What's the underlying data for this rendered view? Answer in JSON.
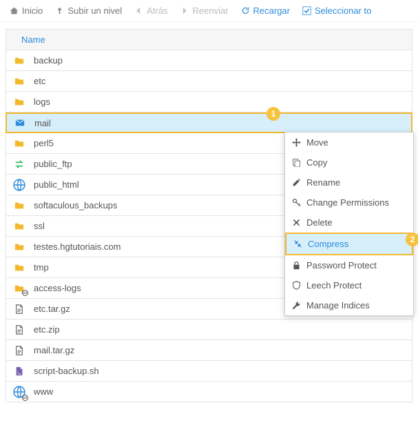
{
  "toolbar": {
    "home": "Inicio",
    "up": "Subir un nivel",
    "back": "Atrás",
    "forward": "Reenviar",
    "reload": "Recargar",
    "select_all": "Seleccionar to"
  },
  "header": {
    "name": "Name"
  },
  "badges": {
    "one": "1",
    "two": "2"
  },
  "rows": [
    {
      "type": "folder",
      "label": "backup"
    },
    {
      "type": "folder",
      "label": "etc"
    },
    {
      "type": "folder",
      "label": "logs"
    },
    {
      "type": "mail",
      "label": "mail",
      "selected": true
    },
    {
      "type": "folder",
      "label": "perl5"
    },
    {
      "type": "ftp",
      "label": "public_ftp"
    },
    {
      "type": "globe",
      "label": "public_html"
    },
    {
      "type": "folder",
      "label": "softaculous_backups"
    },
    {
      "type": "folder",
      "label": "ssl"
    },
    {
      "type": "folder",
      "label": "testes.hgtutoriais.com"
    },
    {
      "type": "folder",
      "label": "tmp"
    },
    {
      "type": "folder-link",
      "label": "access-logs"
    },
    {
      "type": "file",
      "label": "etc.tar.gz"
    },
    {
      "type": "file",
      "label": "etc.zip"
    },
    {
      "type": "file",
      "label": "mail.tar.gz"
    },
    {
      "type": "script",
      "label": "script-backup.sh"
    },
    {
      "type": "globe-link",
      "label": "www"
    }
  ],
  "context": {
    "move": "Move",
    "copy": "Copy",
    "rename": "Rename",
    "perms": "Change Permissions",
    "delete": "Delete",
    "compress": "Compress",
    "password": "Password Protect",
    "leech": "Leech Protect",
    "indices": "Manage Indices"
  }
}
